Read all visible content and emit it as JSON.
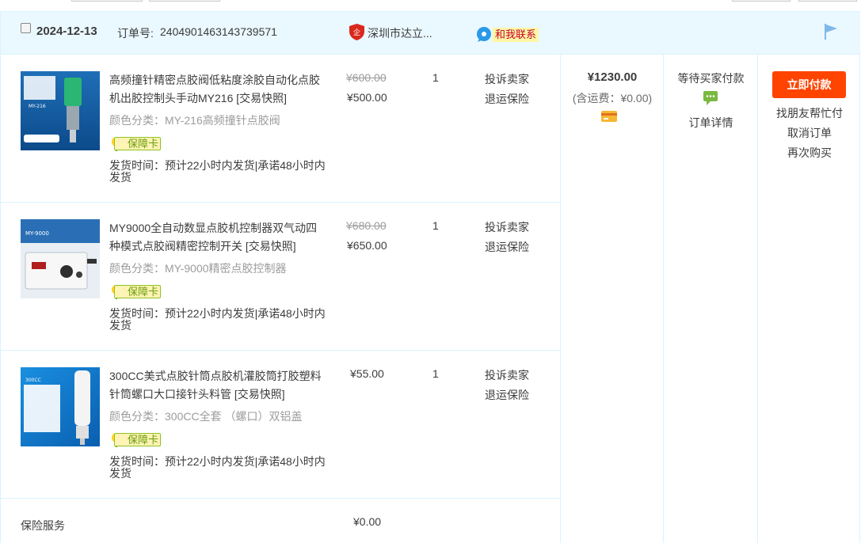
{
  "order": {
    "date": "2024-12-13",
    "order_no_label": "订单号:",
    "order_no": "2404901463143739571",
    "shop": "深圳市达立...",
    "contact_label": "和我联系"
  },
  "items": [
    {
      "title": "高频撞针精密点胶阀低粘度涂胶自动化点胶机出胶控制头手动MY216 [交易快照]",
      "spec": "颜色分类：MY-216高频撞针点胶阀",
      "badge": "保障卡",
      "ship": "发货时间：预计22小时内发货|承诺48小时内发货",
      "original_price": "¥600.00",
      "price": "¥500.00",
      "qty": "1",
      "action1": "投诉卖家",
      "action2": "退运保险",
      "thumb_text": "MY-216"
    },
    {
      "title": "MY9000全自动数显点胶机控制器双气动四种模式点胶阀精密控制开关 [交易快照]",
      "spec": "颜色分类：MY-9000精密点胶控制器",
      "badge": "保障卡",
      "ship": "发货时间：预计22小时内发货|承诺48小时内发货",
      "original_price": "¥680.00",
      "price": "¥650.00",
      "qty": "1",
      "action1": "投诉卖家",
      "action2": "退运保险",
      "thumb_text": "MY-9000"
    },
    {
      "title": "300CC美式点胶针筒点胶机灌胶筒打胶塑料针筒螺口大口接针头料管 [交易快照]",
      "spec": "颜色分类：300CC全套 （螺口）双铝盖",
      "badge": "保障卡",
      "ship": "发货时间：预计22小时内发货|承诺48小时内发货",
      "price": "¥55.00",
      "qty": "1",
      "action1": "投诉卖家",
      "action2": "退运保险",
      "thumb_text": "300CC"
    }
  ],
  "insurance": {
    "label": "保险服务",
    "price": "¥0.00"
  },
  "total": {
    "amount": "¥1230.00",
    "freight": "(含运费：¥0.00)"
  },
  "status": {
    "text": "等待买家付款",
    "detail": "订单详情"
  },
  "ops": {
    "pay": "立即付款",
    "friend_pay": "找朋友帮忙付",
    "cancel": "取消订单",
    "rebuy": "再次购买"
  },
  "colors": {
    "accent": "#ff4400",
    "border": "#daf3ff",
    "header_bg": "#eaf8ff",
    "muted": "#9c9c9c"
  }
}
